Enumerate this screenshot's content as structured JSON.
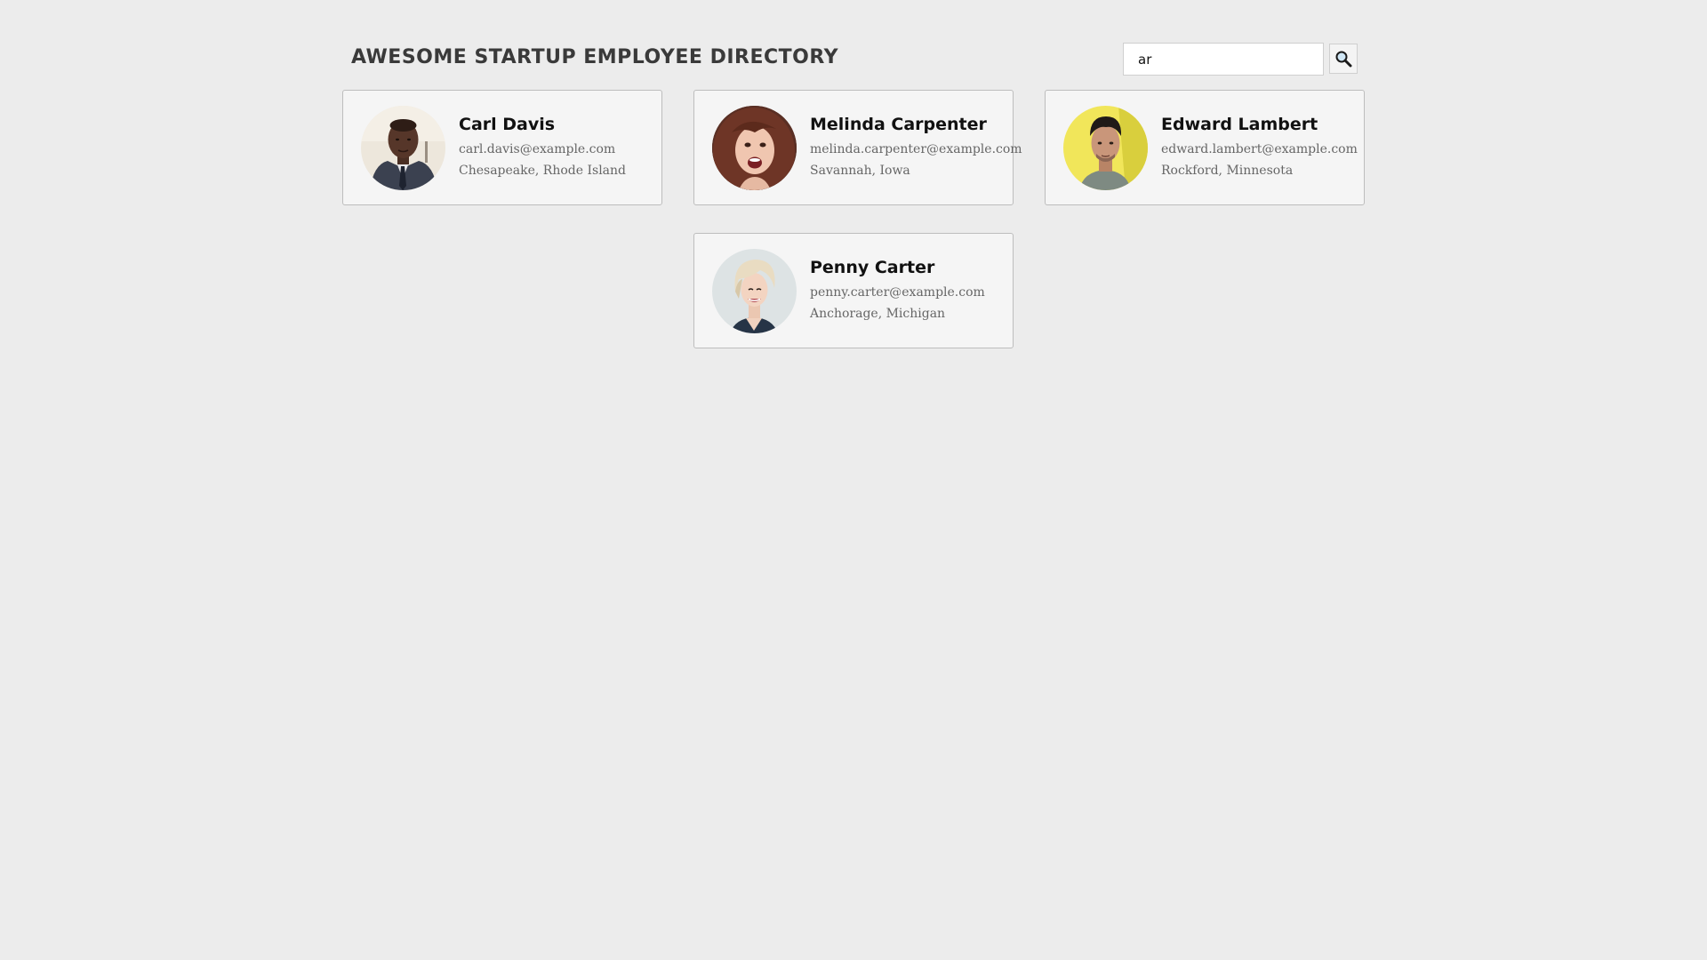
{
  "header": {
    "title": "AWESOME STARTUP EMPLOYEE DIRECTORY"
  },
  "search": {
    "value": "ar",
    "button_icon": "magnifier-icon"
  },
  "employees": [
    {
      "name": "Carl Davis",
      "email": "carl.davis@example.com",
      "location": "Chesapeake, Rhode Island"
    },
    {
      "name": "Melinda Carpenter",
      "email": "melinda.carpenter@example.com",
      "location": "Savannah, Iowa"
    },
    {
      "name": "Edward Lambert",
      "email": "edward.lambert@example.com",
      "location": "Rockford, Minnesota"
    },
    {
      "name": "Penny Carter",
      "email": "penny.carter@example.com",
      "location": "Anchorage, Michigan"
    }
  ],
  "colors": {
    "background": "#ececec",
    "card_background": "#f5f5f5",
    "card_border": "#bdbdbd",
    "title": "#3a3a3a"
  }
}
